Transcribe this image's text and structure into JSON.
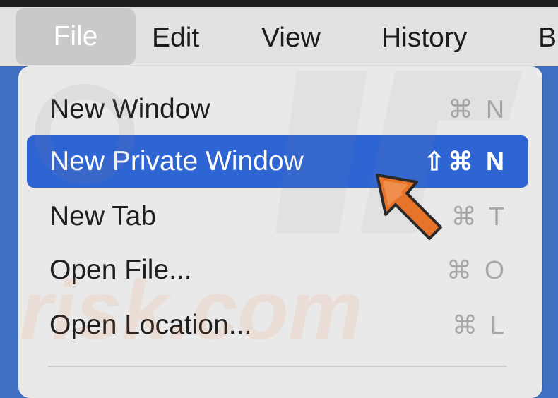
{
  "menubar": {
    "items": [
      {
        "label": "File",
        "active": true
      },
      {
        "label": "Edit"
      },
      {
        "label": "View"
      },
      {
        "label": "History"
      },
      {
        "label": "B"
      }
    ]
  },
  "file_menu": {
    "items": [
      {
        "label": "New Window",
        "shortcut": "⌘ N"
      },
      {
        "label": "New Private Window",
        "shortcut": "⇧⌘ N",
        "highlighted": true
      },
      {
        "label": "New Tab",
        "shortcut": "⌘ T"
      },
      {
        "label": "Open File...",
        "shortcut": "⌘ O"
      },
      {
        "label": "Open Location...",
        "shortcut": "⌘ L"
      }
    ]
  },
  "watermark": {
    "text": "risk.com"
  },
  "colors": {
    "highlight": "#2f64d3",
    "arrow": "#e8742a",
    "menu_background": "#e9e9e9",
    "menubar_background": "#e2e2e2"
  },
  "icons": {
    "pointer": "arrow-pointer-icon"
  }
}
